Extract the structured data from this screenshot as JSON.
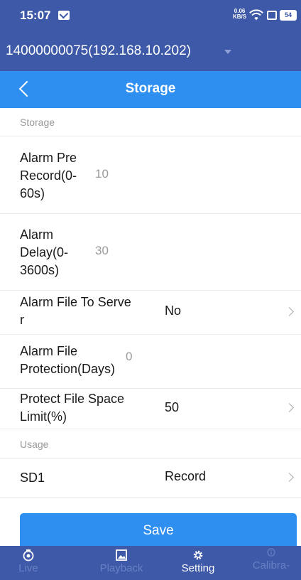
{
  "status_bar": {
    "time": "15:07",
    "net_speed": "0.06",
    "net_unit": "KB/S",
    "battery": "54"
  },
  "device": {
    "name": "14000000075(192.168.10.202)"
  },
  "header": {
    "title": "Storage"
  },
  "sections": {
    "storage": "Storage",
    "usage": "Usage"
  },
  "rows": {
    "alarm_pre_record": {
      "label_lines": [
        "Alarm Pre",
        "Record(0-",
        "60s)"
      ],
      "value": "10"
    },
    "alarm_delay": {
      "label_lines": [
        "Alarm",
        "Delay(0-",
        "3600s)"
      ],
      "value": "30"
    },
    "alarm_file_to_server": {
      "label_lines": [
        "Alarm File To Serve",
        "r"
      ],
      "value": "No"
    },
    "alarm_file_protection": {
      "label_lines": [
        "Alarm File",
        "Protection(Days)"
      ],
      "value": "0"
    },
    "protect_file_space": {
      "label_lines": [
        "Protect File Space",
        "Limit(%)"
      ],
      "value": "50"
    },
    "sd1": {
      "label": "SD1",
      "value": "Record"
    }
  },
  "save_label": "Save",
  "nav": [
    {
      "label": "Live",
      "icon": "camera-icon",
      "active": false
    },
    {
      "label": "Playback",
      "icon": "image-icon",
      "active": false
    },
    {
      "label": "Setting",
      "icon": "gear-icon",
      "active": true
    },
    {
      "label": "Calibra-",
      "icon": "info-icon",
      "active": false
    }
  ],
  "colors": {
    "status_bar": "#3d59a8",
    "title_bar": "#2f8ff0",
    "nav_inactive": "#6a80c4"
  }
}
